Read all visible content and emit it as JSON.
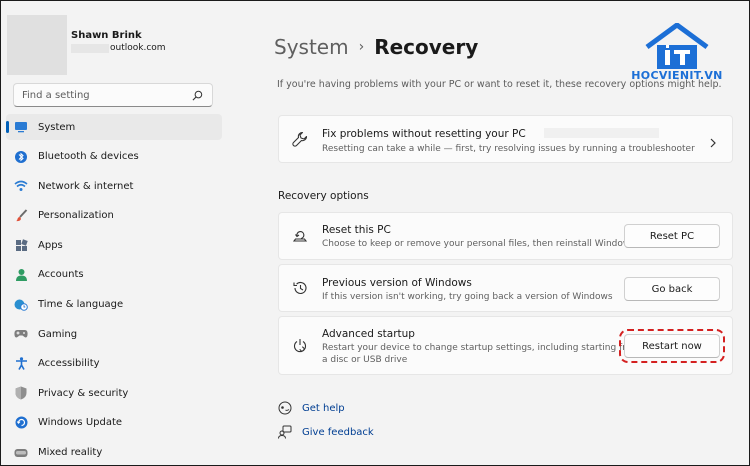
{
  "user": {
    "name": "Shawn Brink",
    "email_suffix": "outlook.com"
  },
  "search": {
    "placeholder": "Find a setting"
  },
  "sidebar": {
    "items": [
      {
        "label": "System",
        "icon": "monitor-icon",
        "active": true
      },
      {
        "label": "Bluetooth & devices",
        "icon": "bluetooth-icon"
      },
      {
        "label": "Network & internet",
        "icon": "wifi-icon"
      },
      {
        "label": "Personalization",
        "icon": "brush-icon"
      },
      {
        "label": "Apps",
        "icon": "apps-icon"
      },
      {
        "label": "Accounts",
        "icon": "person-icon"
      },
      {
        "label": "Time & language",
        "icon": "globe-clock-icon"
      },
      {
        "label": "Gaming",
        "icon": "gamepad-icon"
      },
      {
        "label": "Accessibility",
        "icon": "accessibility-icon"
      },
      {
        "label": "Privacy & security",
        "icon": "shield-icon"
      },
      {
        "label": "Windows Update",
        "icon": "update-icon"
      },
      {
        "label": "Mixed reality",
        "icon": "headset-icon"
      }
    ]
  },
  "header": {
    "parent": "System",
    "separator": "›",
    "current": "Recovery"
  },
  "intro": "If you're having problems with your PC or want to reset it, these recovery options might help.",
  "fix_card": {
    "title": "Fix problems without resetting your PC",
    "description": "Resetting can take a while — first, try resolving issues by running a troubleshooter"
  },
  "recovery_options": {
    "title": "Recovery options",
    "items": [
      {
        "title": "Reset this PC",
        "description": "Choose to keep or remove your personal files, then reinstall Windows",
        "button": "Reset PC",
        "icon": "reset-pc-icon"
      },
      {
        "title": "Previous version of Windows",
        "description": "If this version isn't working, try going back a version of Windows",
        "button": "Go back",
        "icon": "history-icon"
      },
      {
        "title": "Advanced startup",
        "description_line1": "Restart your device to change startup settings, including starting from",
        "description_line2": "a disc or USB drive",
        "button": "Restart now",
        "icon": "power-restart-icon"
      }
    ]
  },
  "help": {
    "get_help": "Get help",
    "give_feedback": "Give feedback"
  },
  "watermark": {
    "text": "HOCVIENIT.VN"
  },
  "colors": {
    "accent": "#005fb8",
    "link": "#003e92",
    "highlight": "#d42020",
    "logo": "#1c6fd6"
  }
}
